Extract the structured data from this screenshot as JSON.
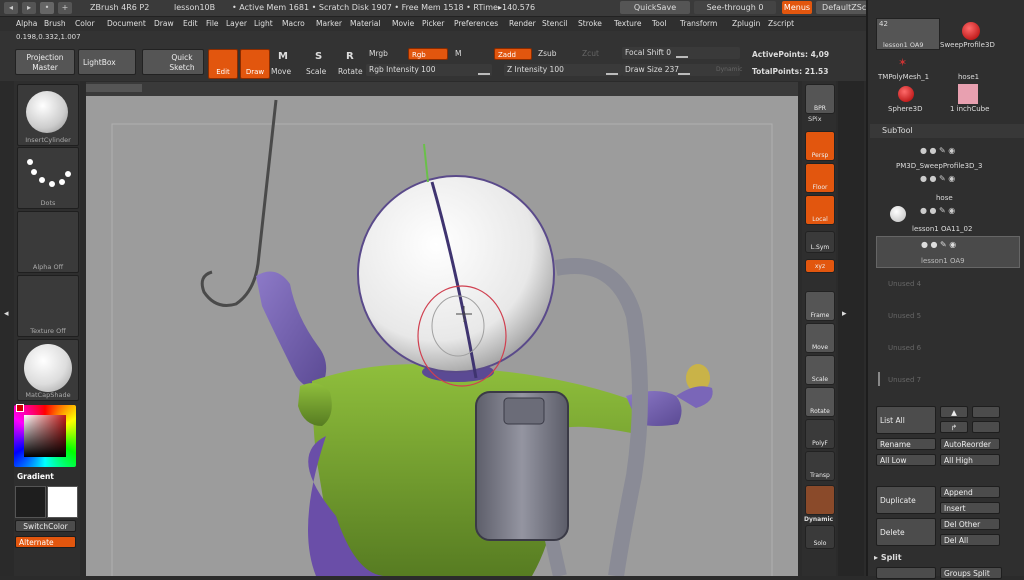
{
  "titlebar": {
    "app": "ZBrush 4R6 P2",
    "doc": "lesson10B",
    "mem": "• Active Mem 1681  • Scratch Disk 1907  • Free Mem 1518  • RTime▸140.576",
    "quicksave": "QuickSave",
    "seethrough": "See-through  0",
    "menus": "Menus",
    "script": "DefaultZScript"
  },
  "menubar": [
    "Alpha",
    "Brush",
    "Color",
    "Document",
    "Draw",
    "Edit",
    "File",
    "Layer",
    "Light",
    "Macro",
    "Marker",
    "Material",
    "Movie",
    "Picker",
    "Preferences",
    "Render",
    "Stencil",
    "Stroke",
    "Texture",
    "Tool",
    "Transform",
    "Zplugin",
    "Zscript"
  ],
  "coords": "0.198,0.332,1.007",
  "shelf": {
    "projection_master": "Projection Master",
    "lightbox": "LightBox",
    "quick_sketch": "Quick Sketch",
    "edit": "Edit",
    "draw": "Draw",
    "move": "Move",
    "scale": "Scale",
    "rotate": "Rotate",
    "mrgb": "Mrgb",
    "rgb": "Rgb",
    "m": "M",
    "zadd": "Zadd",
    "zsub": "Zsub",
    "zcut": "Zcut",
    "rgb_intensity": "Rgb Intensity 100",
    "z_intensity": "Z Intensity 100",
    "focal_shift": "Focal Shift 0",
    "draw_size": "Draw Size 237",
    "dynamic": "Dynamic",
    "active_points": "ActivePoints: 4,09",
    "total_points": "TotalPoints: 21.53"
  },
  "leftshelf": {
    "brush": "InsertCylinder",
    "stroke": "Dots",
    "alpha": "Alpha Off",
    "texture": "Texture Off",
    "material": "MatCapShade",
    "gradient": "Gradient",
    "switchcolor": "SwitchColor",
    "alternate": "Alternate"
  },
  "rightshelf": [
    "BPR",
    "SPix",
    "Persp",
    "Floor",
    "Local",
    "L.Sym",
    "xyz",
    "Frame",
    "Move",
    "Scale",
    "Rotate",
    "PolyF",
    "Transp",
    "Dynamic",
    "Solo"
  ],
  "tools": {
    "top_count": "42",
    "items": [
      "lesson1 OA9",
      "SweepProfile3D",
      "TMPolyMesh_1",
      "hose1",
      "Sphere3D",
      "1 inchCube"
    ]
  },
  "subtool": {
    "title": "SubTool",
    "rows": [
      "PM3D_SweepProfile3D_3",
      "hose",
      "lesson1 OA11_02",
      "lesson1 OA9"
    ],
    "unused": [
      "Unused 4",
      "Unused 5",
      "Unused 6",
      "Unused 7"
    ],
    "buttons": {
      "list_all": "List All",
      "rename": "Rename",
      "autoreorder": "AutoReorder",
      "all_low": "All Low",
      "all_high": "All High",
      "duplicate": "Duplicate",
      "append": "Append",
      "insert": "Insert",
      "delete": "Delete",
      "del_other": "Del Other",
      "del_all": "Del All",
      "split": "Split",
      "groups_split": "Groups Split"
    }
  }
}
